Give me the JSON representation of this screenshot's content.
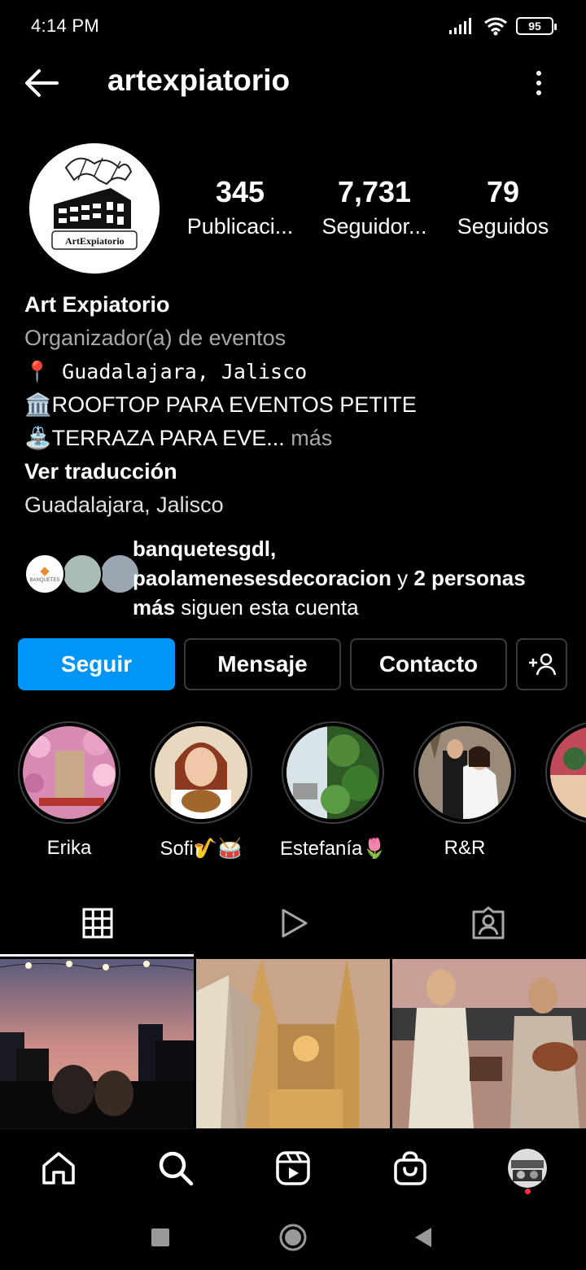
{
  "status_bar": {
    "time": "4:14 PM",
    "battery": "95"
  },
  "header": {
    "username": "artexpiatorio"
  },
  "profile": {
    "avatar_text": "ArtExpiatorio",
    "stats": [
      {
        "value": "345",
        "label": "Publicaci..."
      },
      {
        "value": "7,731",
        "label": "Seguidor..."
      },
      {
        "value": "79",
        "label": "Seguidos"
      }
    ]
  },
  "bio": {
    "name": "Art Expiatorio",
    "category": "Organizador(a) de eventos",
    "line1": "📍 Guadalajara, Jalisco",
    "line2": "🏛️ROOFTOP PARA EVENTOS PETITE",
    "line3": "⛲TERRAZA PARA EVE...",
    "more": "más",
    "translate": "Ver traducción",
    "location": "Guadalajara, Jalisco"
  },
  "followed_by": {
    "user1": "banquetesgdl,",
    "user2": "paolamenesesdecoracion",
    "connector": " y ",
    "others": "2 personas",
    "others2": "más",
    "suffix": " siguen esta cuenta",
    "mini_logo_text": "BANQUETES"
  },
  "actions": {
    "follow": "Seguir",
    "message": "Mensaje",
    "contact": "Contacto"
  },
  "highlights": [
    {
      "label": "Erika"
    },
    {
      "label": "Sofi🎷🥁"
    },
    {
      "label": "Estefanía🌷"
    },
    {
      "label": "R&R"
    },
    {
      "label": "🎄"
    }
  ],
  "colors": {
    "accent": "#0095f6",
    "notification": "#ff3040"
  }
}
